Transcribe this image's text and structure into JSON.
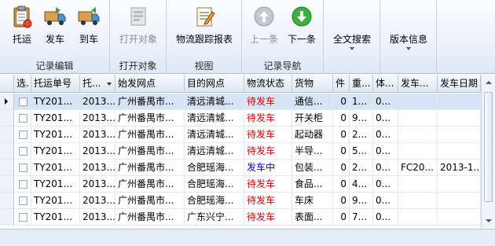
{
  "ribbon": {
    "groups": [
      {
        "label": "记录编辑",
        "buttons": [
          {
            "label": "托运",
            "icon": "clipboard-icon"
          },
          {
            "label": "发车",
            "icon": "truck-icon"
          },
          {
            "label": "到车",
            "icon": "truck-arrive-icon"
          }
        ]
      },
      {
        "label": "打开对象",
        "buttons": [
          {
            "label": "打开对象",
            "icon": "open-object-icon"
          }
        ]
      },
      {
        "label": "视图",
        "buttons": [
          {
            "label": "物流跟踪报表",
            "icon": "report-icon"
          }
        ]
      },
      {
        "label": "记录导航",
        "buttons": [
          {
            "label": "上一条",
            "icon": "arrow-up-icon"
          },
          {
            "label": "下一条",
            "icon": "arrow-down-icon"
          }
        ]
      },
      {
        "label": "",
        "buttons": [
          {
            "label": "全文搜索",
            "icon": "dropdown-icon"
          }
        ]
      },
      {
        "label": "",
        "buttons": [
          {
            "label": "版本信息",
            "icon": "dropdown-icon"
          }
        ]
      }
    ]
  },
  "grid": {
    "columns": [
      "选.",
      "托运单号",
      "托...",
      "始发网点",
      "目的网点",
      "物流状态",
      "货物",
      "件",
      "重...",
      "体...",
      "发车...",
      "发车日期"
    ],
    "rows": [
      [
        "TY201...",
        "2013...",
        "广州番禺市...",
        "清远清城...",
        "待发车",
        "通信...",
        "0",
        "1...",
        "0...",
        "",
        ""
      ],
      [
        "TY201...",
        "2013...",
        "广州番禺市...",
        "清远清城...",
        "待发车",
        "开关柜",
        "0",
        "9...",
        "0...",
        "",
        ""
      ],
      [
        "TY201...",
        "2013...",
        "广州番禺市...",
        "清远清城...",
        "待发车",
        "起动器",
        "0",
        "2...",
        "0...",
        "",
        ""
      ],
      [
        "TY201...",
        "2013...",
        "广州番禺市...",
        "清远清城...",
        "待发车",
        "半导...",
        "0",
        "5...",
        "0...",
        "",
        ""
      ],
      [
        "TY201...",
        "2013...",
        "广州番禺市...",
        "合肥瑶海...",
        "发车中",
        "包装...",
        "0",
        "2...",
        "0...",
        "FC20...",
        "2013-1..."
      ],
      [
        "TY201...",
        "2013...",
        "广州番禺市...",
        "合肥瑶海...",
        "待发车",
        "食品...",
        "0",
        "4...",
        "0...",
        "",
        ""
      ],
      [
        "TY201...",
        "2013...",
        "广州番禺市...",
        "合肥瑶海...",
        "待发车",
        "车床",
        "0",
        "9...",
        "0...",
        "",
        ""
      ],
      [
        "TY201...",
        "2013...",
        "广州番禺市...",
        "广东兴宁...",
        "待发车",
        "表面...",
        "0",
        "7...",
        "0...",
        "",
        ""
      ]
    ],
    "status_colors": {
      "待发车": "#e00000",
      "发车中": "#0000d0"
    }
  }
}
